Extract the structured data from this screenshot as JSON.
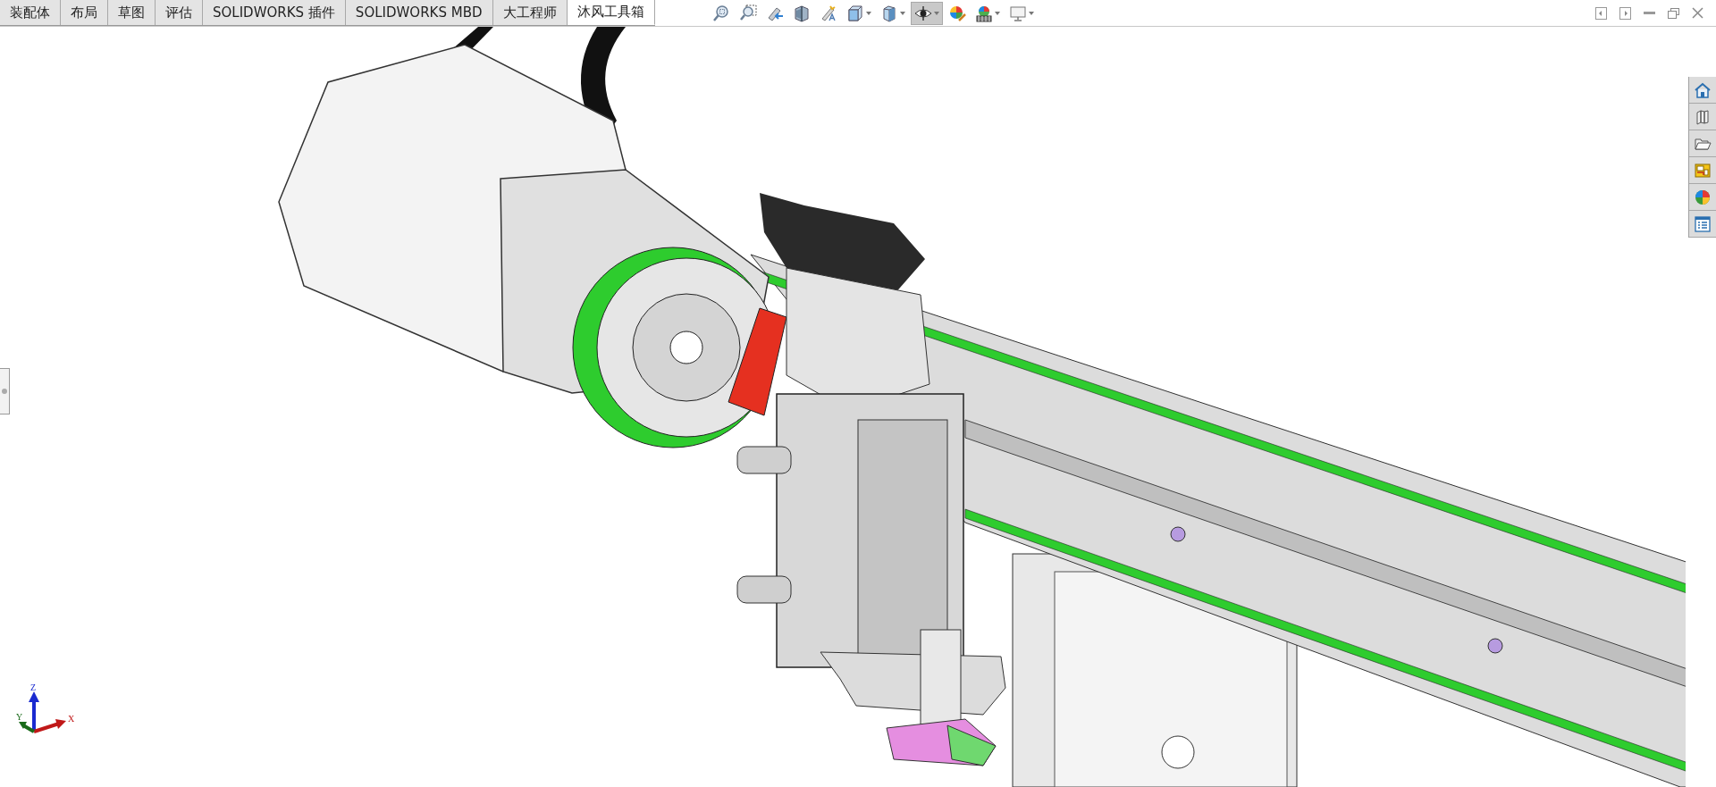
{
  "tabs": [
    {
      "label": "装配体",
      "selected": false
    },
    {
      "label": "布局",
      "selected": false
    },
    {
      "label": "草图",
      "selected": false
    },
    {
      "label": "评估",
      "selected": false
    },
    {
      "label": "SOLIDWORKS 插件",
      "selected": false
    },
    {
      "label": "SOLIDWORKS MBD",
      "selected": false
    },
    {
      "label": "大工程师",
      "selected": false
    },
    {
      "label": "沐风工具箱",
      "selected": true
    }
  ],
  "view_toolbar": [
    {
      "kind": "zoom-fit",
      "dropdown": false,
      "pressed": false
    },
    {
      "kind": "zoom-area",
      "dropdown": false,
      "pressed": false
    },
    {
      "kind": "previous-view",
      "dropdown": false,
      "pressed": false
    },
    {
      "kind": "section",
      "dropdown": false,
      "pressed": false
    },
    {
      "kind": "wand",
      "dropdown": false,
      "pressed": false
    },
    {
      "kind": "orientation",
      "dropdown": true,
      "pressed": false
    },
    {
      "kind": "display-style",
      "dropdown": true,
      "pressed": false
    },
    {
      "kind": "hide-show",
      "dropdown": true,
      "pressed": true
    },
    {
      "kind": "appearance",
      "dropdown": false,
      "pressed": false
    },
    {
      "kind": "scene",
      "dropdown": true,
      "pressed": false
    },
    {
      "kind": "monitor",
      "dropdown": true,
      "pressed": false
    }
  ],
  "task_pane": [
    {
      "kind": "home"
    },
    {
      "kind": "library"
    },
    {
      "kind": "folder"
    },
    {
      "kind": "palette"
    },
    {
      "kind": "appearance"
    },
    {
      "kind": "properties"
    }
  ],
  "triad": {
    "x": "X",
    "y": "Y",
    "z": "Z"
  }
}
